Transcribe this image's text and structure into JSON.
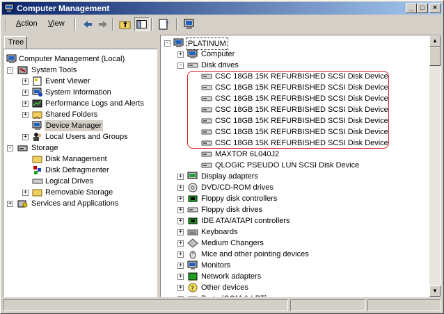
{
  "window": {
    "title": "Computer Management"
  },
  "titlebar_buttons": {
    "minimize": "_",
    "maximize": "□",
    "close": "×"
  },
  "menu": {
    "action": "Action",
    "view": "View"
  },
  "left": {
    "tab": "Tree",
    "items": [
      {
        "label": "Computer Management (Local)"
      },
      {
        "label": "System Tools"
      },
      {
        "label": "Event Viewer"
      },
      {
        "label": "System Information"
      },
      {
        "label": "Performance Logs and Alerts"
      },
      {
        "label": "Shared Folders"
      },
      {
        "label": "Device Manager"
      },
      {
        "label": "Local Users and Groups"
      },
      {
        "label": "Storage"
      },
      {
        "label": "Disk Management"
      },
      {
        "label": "Disk Defragmenter"
      },
      {
        "label": "Logical Drives"
      },
      {
        "label": "Removable Storage"
      },
      {
        "label": "Services and Applications"
      }
    ]
  },
  "right": {
    "root": "PLATINUM",
    "items": [
      {
        "label": "Computer"
      },
      {
        "label": "Disk drives"
      },
      {
        "label": "CSC 18GB 15K REFURBISHED SCSI Disk Device"
      },
      {
        "label": "CSC 18GB 15K REFURBISHED SCSI Disk Device"
      },
      {
        "label": "CSC 18GB 15K REFURBISHED SCSI Disk Device"
      },
      {
        "label": "CSC 18GB 15K REFURBISHED SCSI Disk Device"
      },
      {
        "label": "CSC 18GB 15K REFURBISHED SCSI Disk Device"
      },
      {
        "label": "CSC 18GB 15K REFURBISHED SCSI Disk Device"
      },
      {
        "label": "CSC 18GB 15K REFURBISHED SCSI Disk Device"
      },
      {
        "label": "MAXTOR 6L040J2"
      },
      {
        "label": "QLOGIC PSEUDO LUN SCSI Disk Device"
      },
      {
        "label": "Display adapters"
      },
      {
        "label": "DVD/CD-ROM drives"
      },
      {
        "label": "Floppy disk controllers"
      },
      {
        "label": "Floppy disk drives"
      },
      {
        "label": "IDE ATA/ATAPI controllers"
      },
      {
        "label": "Keyboards"
      },
      {
        "label": "Medium Changers"
      },
      {
        "label": "Mice and other pointing devices"
      },
      {
        "label": "Monitors"
      },
      {
        "label": "Network adapters"
      },
      {
        "label": "Other devices"
      },
      {
        "label": "Ports (COM & LPT)"
      }
    ]
  },
  "colors": {
    "titlebar": "#0a246a",
    "highlight_box": "#d02020",
    "face": "#d4d0c8"
  }
}
